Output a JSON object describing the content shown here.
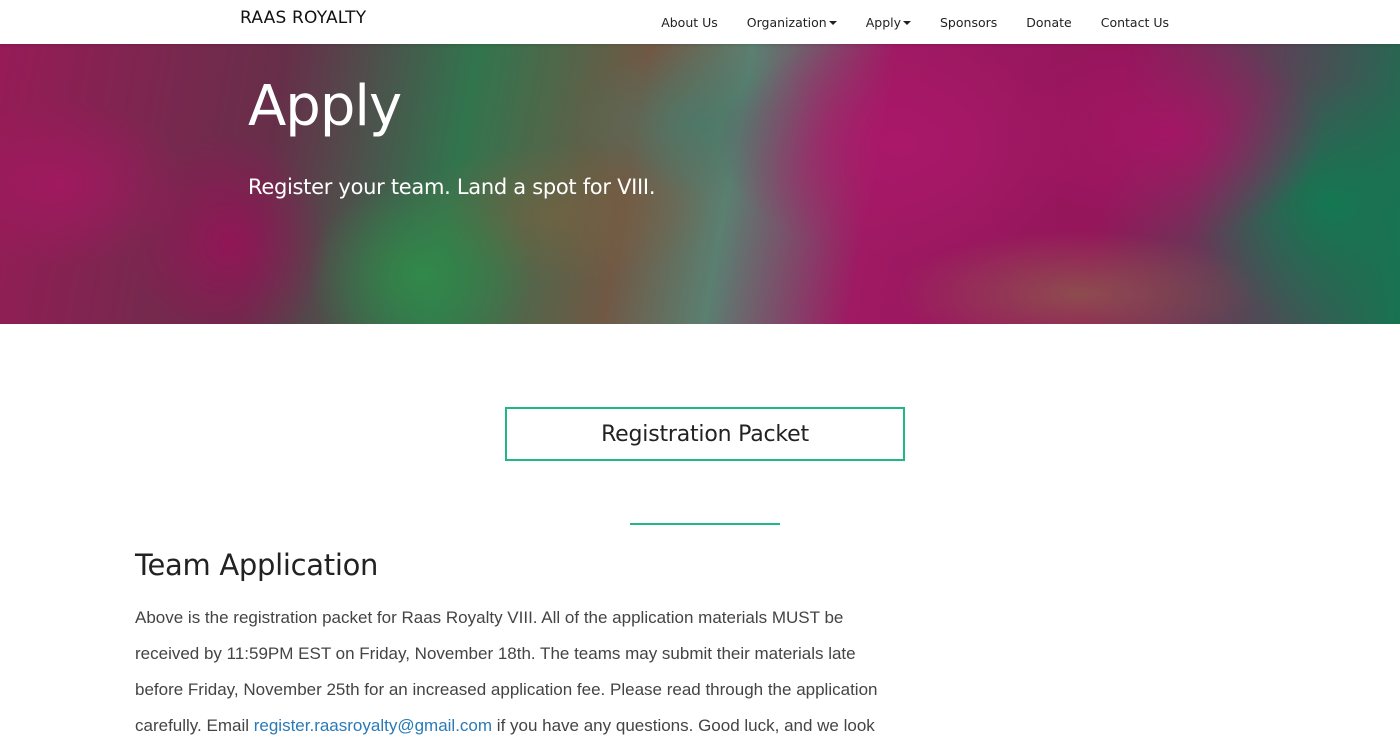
{
  "nav": {
    "brand": "RAAS ROYALTY",
    "items": [
      {
        "label": "About Us",
        "dropdown": false
      },
      {
        "label": "Organization",
        "dropdown": true
      },
      {
        "label": "Apply",
        "dropdown": true
      },
      {
        "label": "Sponsors",
        "dropdown": false
      },
      {
        "label": "Donate",
        "dropdown": false
      },
      {
        "label": "Contact Us",
        "dropdown": false
      }
    ]
  },
  "hero": {
    "title": "Apply",
    "subtitle": "Register your team. Land a spot for VIII."
  },
  "packet_button": {
    "label": "Registration Packet"
  },
  "section": {
    "title": "Team Application",
    "paragraph_before_link": "Above is the registration packet for Raas Royalty VIII. All of the application materials MUST be received by 11:59PM EST on Friday, November 18th. The teams may submit their materials late before Friday, November 25th for an increased application fee. Please read through the application carefully. Email ",
    "email_link": "register.raasroyalty@gmail.com",
    "paragraph_after_link": " if you have any questions. Good luck, and we look"
  },
  "colors": {
    "accent": "#1fb783",
    "link": "#2a7ab8"
  }
}
